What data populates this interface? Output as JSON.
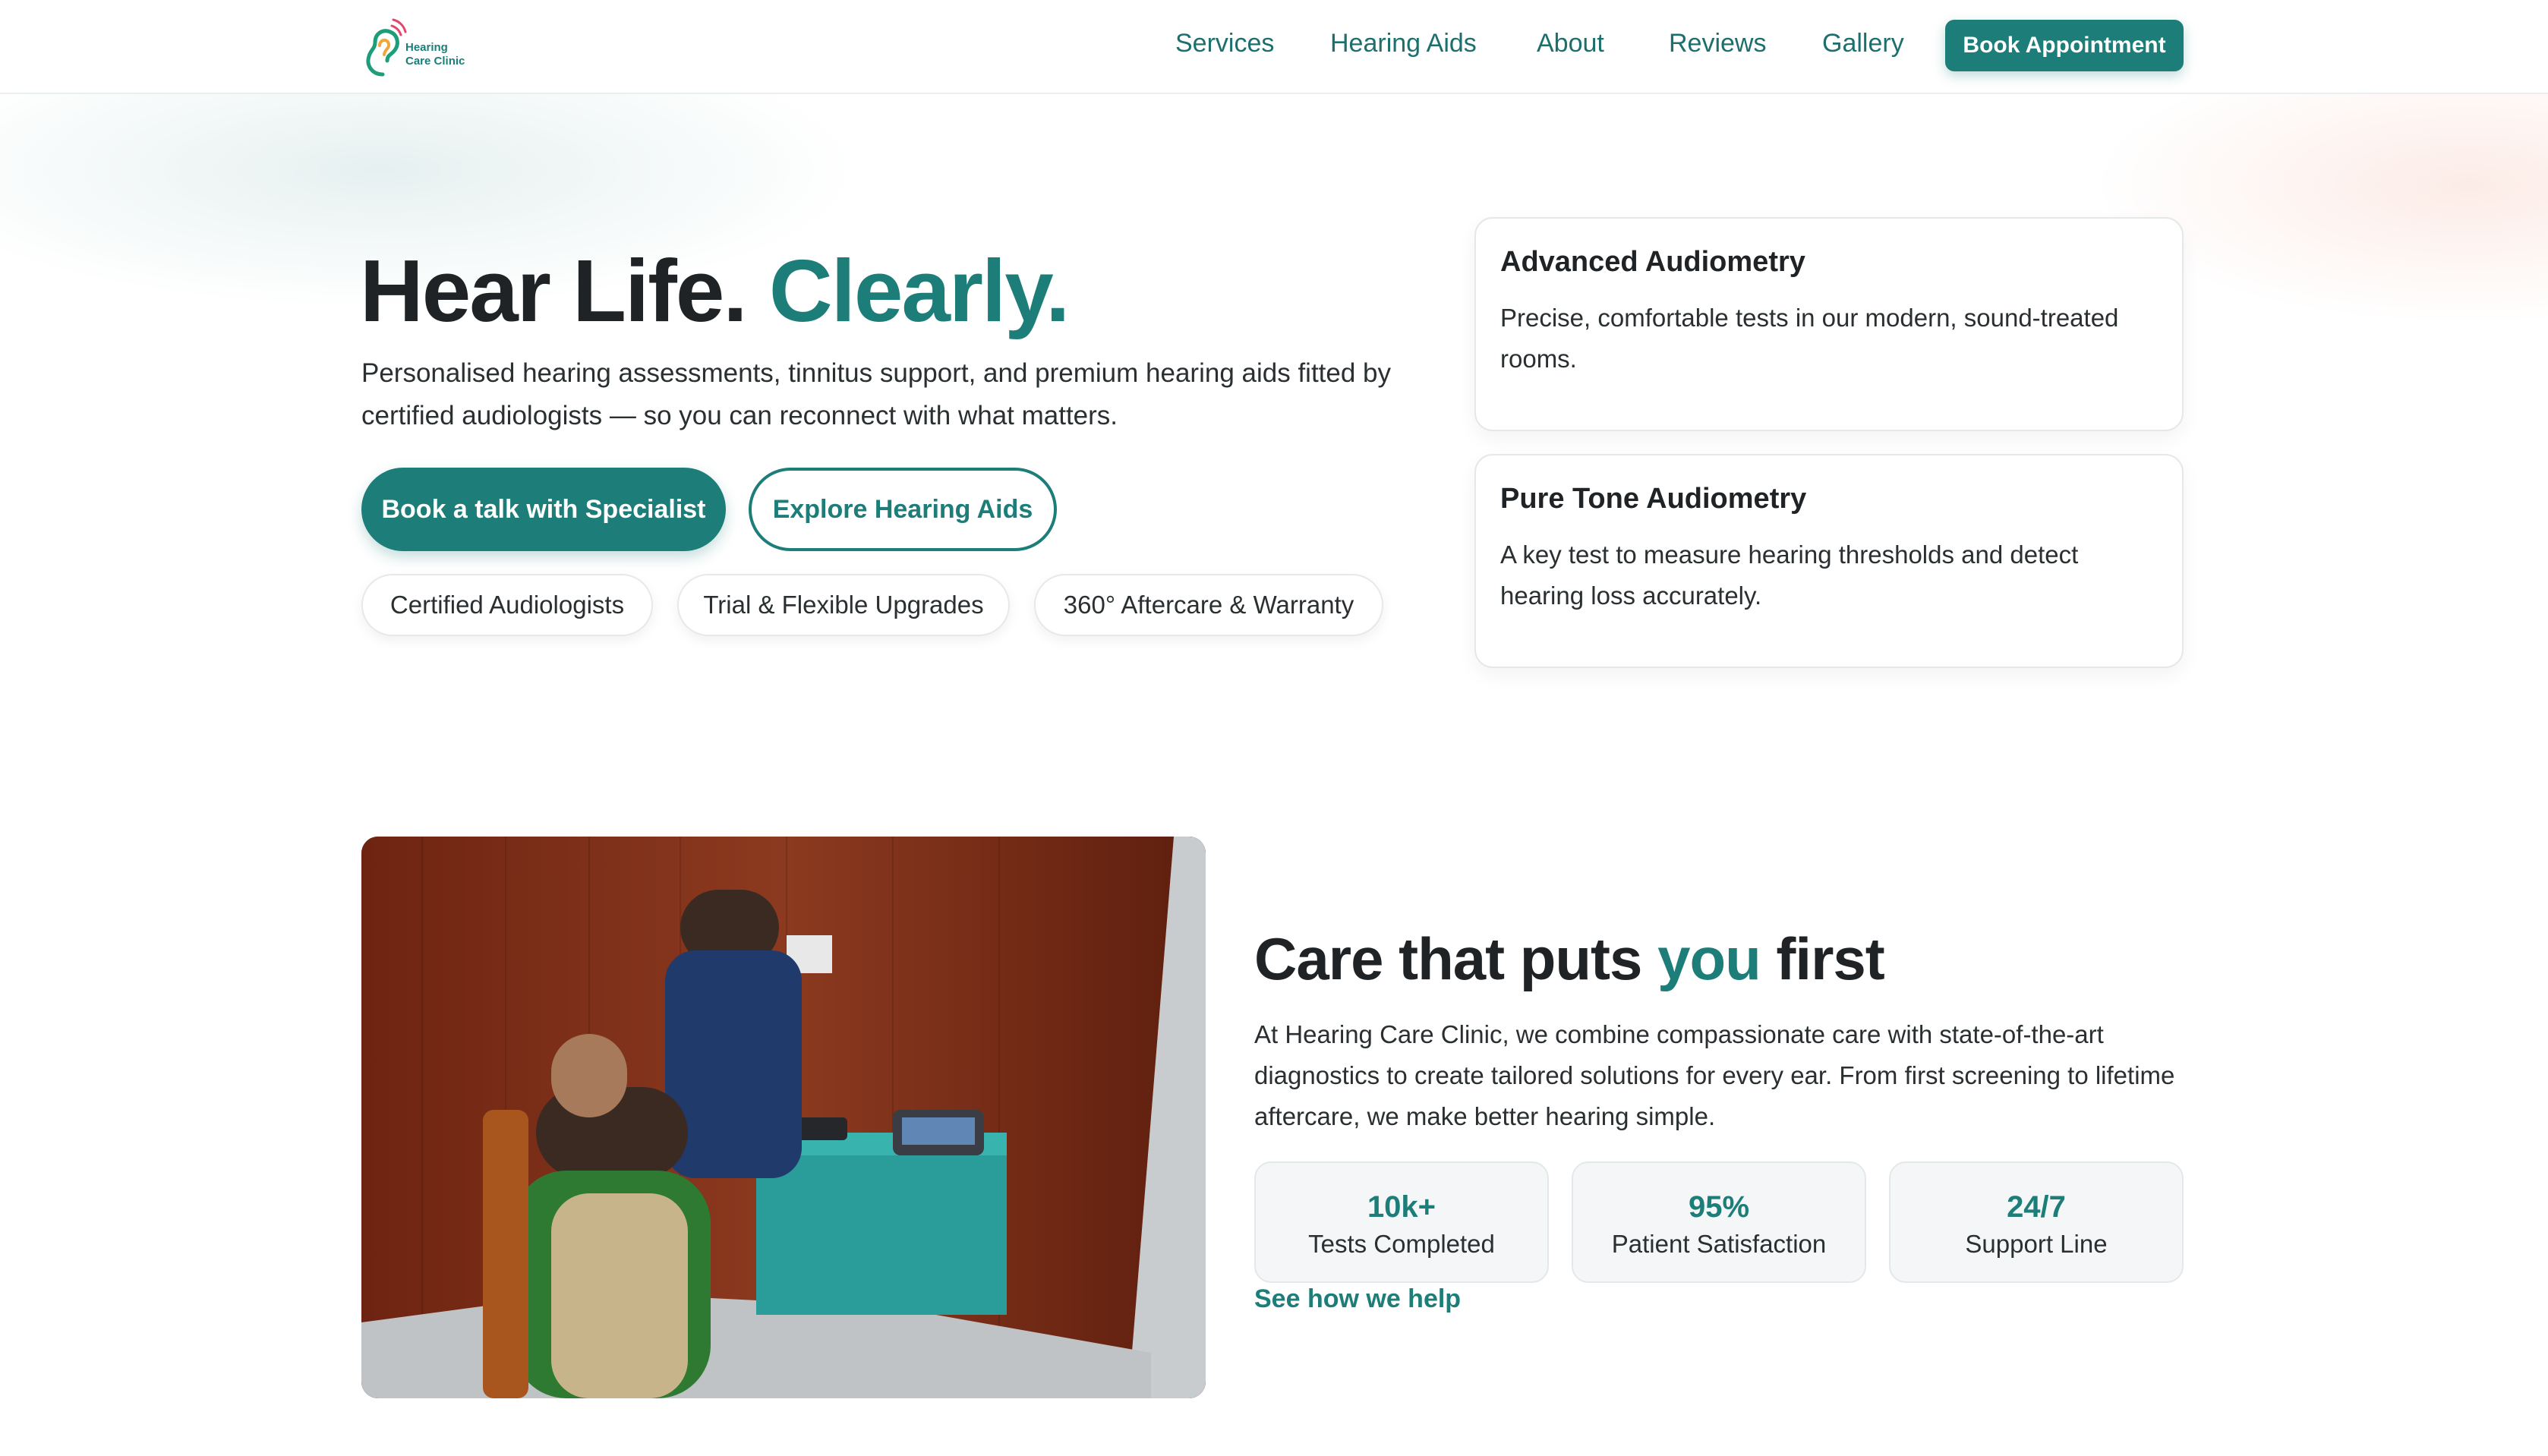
{
  "brand": {
    "name_line1": "Hearing",
    "name_line2": "Care Clinic",
    "accent_color": "#1d7d79"
  },
  "nav": {
    "items": [
      {
        "label": "Services"
      },
      {
        "label": "Hearing Aids"
      },
      {
        "label": "About"
      },
      {
        "label": "Reviews"
      },
      {
        "label": "Gallery"
      }
    ],
    "cta": "Book Appointment"
  },
  "hero": {
    "title_main": "Hear Life.",
    "title_accent": "Clearly.",
    "description": "Personalised hearing assessments, tinnitus support, and premium hearing aids fitted by certified audiologists — so you can reconnect with what matters.",
    "primary_button": "Book a talk with Specialist",
    "secondary_button": "Explore Hearing Aids",
    "pills": [
      "Certified Audiologists",
      "Trial & Flexible Upgrades",
      "360° Aftercare & Warranty"
    ]
  },
  "cards": [
    {
      "title": "Advanced Audiometry",
      "body": "Precise, comfortable tests in our modern, sound-treated rooms."
    },
    {
      "title": "Pure Tone Audiometry",
      "body": "A key test to measure hearing thresholds and detect hearing loss accurately."
    }
  ],
  "care": {
    "title_before": "Care that puts ",
    "title_accent": "you",
    "title_after": " first",
    "description": "At Hearing Care Clinic, we combine compassionate care with state-of-the-art diagnostics to create tailored solutions for every ear. From first screening to lifetime aftercare, we make better hearing simple.",
    "stats": [
      {
        "value": "10k+",
        "label": "Tests Completed"
      },
      {
        "value": "95%",
        "label": "Patient Satisfaction"
      },
      {
        "value": "24/7",
        "label": "Support Line"
      }
    ],
    "link": "See how we help"
  }
}
